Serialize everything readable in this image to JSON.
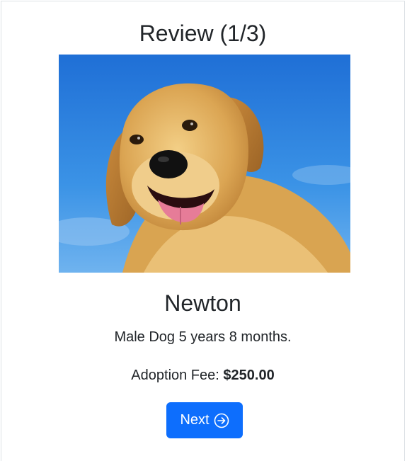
{
  "review": {
    "title": "Review (1/3)"
  },
  "pet": {
    "photo_icon": "golden-retriever-photo",
    "name": "Newton",
    "details": "Male Dog 5 years 8 months.",
    "fee_label": "Adoption Fee:",
    "fee_value": "$250.00"
  },
  "actions": {
    "next_label": "Next",
    "next_icon": "arrow-right-circle-icon"
  },
  "colors": {
    "primary": "#0d6efd",
    "sky": "#2f8ae0",
    "fur": "#d9a451"
  }
}
